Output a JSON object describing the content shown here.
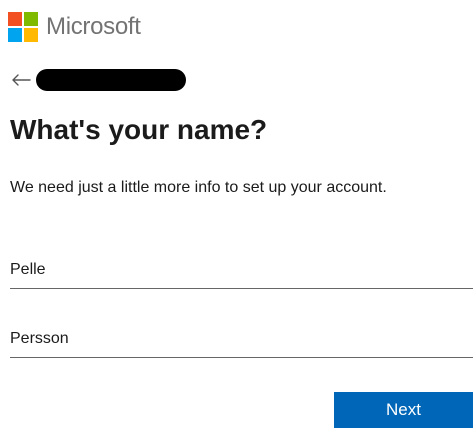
{
  "brand": {
    "name": "Microsoft",
    "logo_colors": [
      "#f25022",
      "#7fba00",
      "#00a4ef",
      "#ffb900"
    ]
  },
  "identity": {
    "back_icon": "arrow-left-icon",
    "account_redacted": true
  },
  "page": {
    "title": "What's your name?",
    "description": "We need just a little more info to set up your account."
  },
  "form": {
    "first_name": {
      "value": "Pelle"
    },
    "last_name": {
      "value": "Persson"
    }
  },
  "actions": {
    "next_label": "Next",
    "accent_color": "#0067b8"
  }
}
